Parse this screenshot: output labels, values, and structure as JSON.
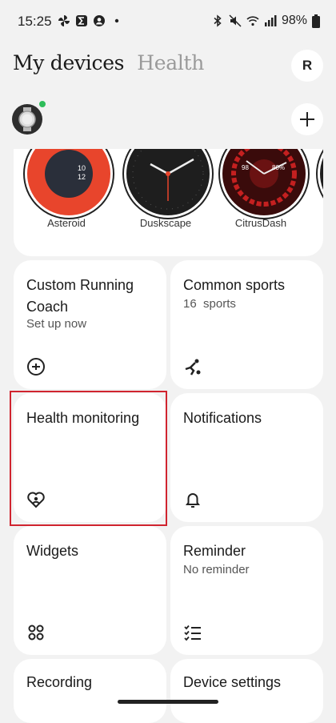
{
  "status": {
    "time": "15:25",
    "battery": "98%"
  },
  "header": {
    "tabs": [
      "My devices",
      "Health"
    ],
    "avatar_letter": "R"
  },
  "watch_faces": [
    {
      "name": "Asteroid",
      "time_top": "10",
      "time_bottom": "12"
    },
    {
      "name": "Duskscape"
    },
    {
      "name": "CitrusDash",
      "left_value": "98",
      "right_value": "80%"
    }
  ],
  "cards": {
    "running_coach": {
      "title": "Custom Running Coach",
      "subtitle": "Set up now",
      "icon": "running-coach-icon"
    },
    "common_sports": {
      "title": "Common sports",
      "count": "16",
      "unit": "sports",
      "icon": "sports-icon"
    },
    "health_monitoring": {
      "title": "Health monitoring",
      "icon": "heart-health-icon"
    },
    "notifications": {
      "title": "Notifications",
      "icon": "bell-icon"
    },
    "widgets": {
      "title": "Widgets",
      "icon": "widgets-icon"
    },
    "reminder": {
      "title": "Reminder",
      "subtitle": "No reminder",
      "icon": "checklist-icon"
    },
    "recording": {
      "title": "Recording"
    },
    "device_settings": {
      "title": "Device settings"
    }
  },
  "colors": {
    "accent_red": "#d0242f",
    "face_orange": "#e8452c",
    "background": "#f2f2f2"
  }
}
